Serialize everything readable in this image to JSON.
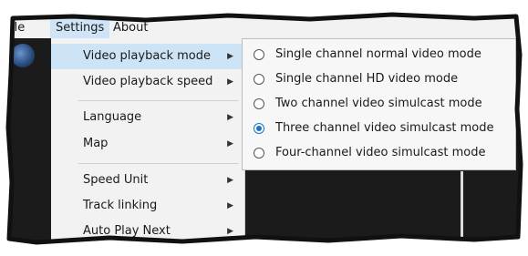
{
  "menubar": {
    "file_label": "ile",
    "settings_label": "Settings",
    "about_label": "About"
  },
  "settings_menu": {
    "items": [
      {
        "label": "Video playback mode",
        "has_submenu": true,
        "highlighted": true
      },
      {
        "label": "Video playback speed",
        "has_submenu": true
      },
      {
        "label": "Language",
        "has_submenu": true
      },
      {
        "label": "Map",
        "has_submenu": true
      },
      {
        "label": "Speed Unit",
        "has_submenu": true
      },
      {
        "label": "Track linking",
        "has_submenu": true
      },
      {
        "label": "Auto Play Next",
        "has_submenu": true
      }
    ],
    "arrow_glyph": "▶"
  },
  "playback_mode_submenu": {
    "options": [
      {
        "label": "Single channel normal video mode",
        "selected": false
      },
      {
        "label": "Single channel HD video mode",
        "selected": false
      },
      {
        "label": "Two channel video simulcast mode",
        "selected": false
      },
      {
        "label": "Three channel video simulcast mode",
        "selected": true
      },
      {
        "label": "Four-channel video simulcast mode",
        "selected": false
      }
    ]
  },
  "colors": {
    "highlight": "#cde4f7",
    "radio_selected": "#1a73c9",
    "app_background": "#1b1b1b"
  }
}
